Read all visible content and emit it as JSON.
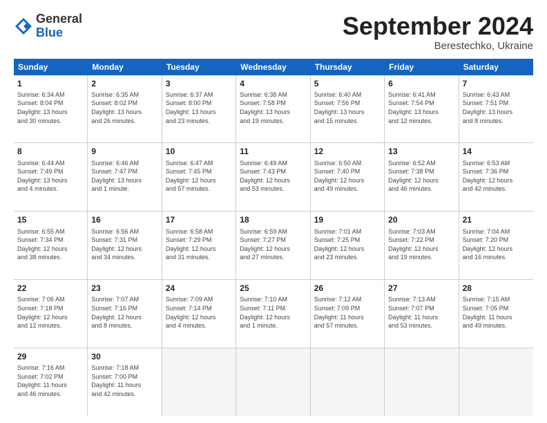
{
  "header": {
    "logo_general": "General",
    "logo_blue": "Blue",
    "month_title": "September 2024",
    "subtitle": "Berestechko, Ukraine"
  },
  "weekdays": [
    "Sunday",
    "Monday",
    "Tuesday",
    "Wednesday",
    "Thursday",
    "Friday",
    "Saturday"
  ],
  "rows": [
    [
      {
        "day": "1",
        "info": "Sunrise: 6:34 AM\nSunset: 8:04 PM\nDaylight: 13 hours\nand 30 minutes."
      },
      {
        "day": "2",
        "info": "Sunrise: 6:35 AM\nSunset: 8:02 PM\nDaylight: 13 hours\nand 26 minutes."
      },
      {
        "day": "3",
        "info": "Sunrise: 6:37 AM\nSunset: 8:00 PM\nDaylight: 13 hours\nand 23 minutes."
      },
      {
        "day": "4",
        "info": "Sunrise: 6:38 AM\nSunset: 7:58 PM\nDaylight: 13 hours\nand 19 minutes."
      },
      {
        "day": "5",
        "info": "Sunrise: 6:40 AM\nSunset: 7:56 PM\nDaylight: 13 hours\nand 15 minutes."
      },
      {
        "day": "6",
        "info": "Sunrise: 6:41 AM\nSunset: 7:54 PM\nDaylight: 13 hours\nand 12 minutes."
      },
      {
        "day": "7",
        "info": "Sunrise: 6:43 AM\nSunset: 7:51 PM\nDaylight: 13 hours\nand 8 minutes."
      }
    ],
    [
      {
        "day": "8",
        "info": "Sunrise: 6:44 AM\nSunset: 7:49 PM\nDaylight: 13 hours\nand 4 minutes."
      },
      {
        "day": "9",
        "info": "Sunrise: 6:46 AM\nSunset: 7:47 PM\nDaylight: 13 hours\nand 1 minute."
      },
      {
        "day": "10",
        "info": "Sunrise: 6:47 AM\nSunset: 7:45 PM\nDaylight: 12 hours\nand 57 minutes."
      },
      {
        "day": "11",
        "info": "Sunrise: 6:49 AM\nSunset: 7:43 PM\nDaylight: 12 hours\nand 53 minutes."
      },
      {
        "day": "12",
        "info": "Sunrise: 6:50 AM\nSunset: 7:40 PM\nDaylight: 12 hours\nand 49 minutes."
      },
      {
        "day": "13",
        "info": "Sunrise: 6:52 AM\nSunset: 7:38 PM\nDaylight: 12 hours\nand 46 minutes."
      },
      {
        "day": "14",
        "info": "Sunrise: 6:53 AM\nSunset: 7:36 PM\nDaylight: 12 hours\nand 42 minutes."
      }
    ],
    [
      {
        "day": "15",
        "info": "Sunrise: 6:55 AM\nSunset: 7:34 PM\nDaylight: 12 hours\nand 38 minutes."
      },
      {
        "day": "16",
        "info": "Sunrise: 6:56 AM\nSunset: 7:31 PM\nDaylight: 12 hours\nand 34 minutes."
      },
      {
        "day": "17",
        "info": "Sunrise: 6:58 AM\nSunset: 7:29 PM\nDaylight: 12 hours\nand 31 minutes."
      },
      {
        "day": "18",
        "info": "Sunrise: 6:59 AM\nSunset: 7:27 PM\nDaylight: 12 hours\nand 27 minutes."
      },
      {
        "day": "19",
        "info": "Sunrise: 7:01 AM\nSunset: 7:25 PM\nDaylight: 12 hours\nand 23 minutes."
      },
      {
        "day": "20",
        "info": "Sunrise: 7:03 AM\nSunset: 7:22 PM\nDaylight: 12 hours\nand 19 minutes."
      },
      {
        "day": "21",
        "info": "Sunrise: 7:04 AM\nSunset: 7:20 PM\nDaylight: 12 hours\nand 16 minutes."
      }
    ],
    [
      {
        "day": "22",
        "info": "Sunrise: 7:06 AM\nSunset: 7:18 PM\nDaylight: 12 hours\nand 12 minutes."
      },
      {
        "day": "23",
        "info": "Sunrise: 7:07 AM\nSunset: 7:16 PM\nDaylight: 12 hours\nand 8 minutes."
      },
      {
        "day": "24",
        "info": "Sunrise: 7:09 AM\nSunset: 7:14 PM\nDaylight: 12 hours\nand 4 minutes."
      },
      {
        "day": "25",
        "info": "Sunrise: 7:10 AM\nSunset: 7:11 PM\nDaylight: 12 hours\nand 1 minute."
      },
      {
        "day": "26",
        "info": "Sunrise: 7:12 AM\nSunset: 7:09 PM\nDaylight: 11 hours\nand 57 minutes."
      },
      {
        "day": "27",
        "info": "Sunrise: 7:13 AM\nSunset: 7:07 PM\nDaylight: 11 hours\nand 53 minutes."
      },
      {
        "day": "28",
        "info": "Sunrise: 7:15 AM\nSunset: 7:05 PM\nDaylight: 11 hours\nand 49 minutes."
      }
    ],
    [
      {
        "day": "29",
        "info": "Sunrise: 7:16 AM\nSunset: 7:02 PM\nDaylight: 11 hours\nand 46 minutes."
      },
      {
        "day": "30",
        "info": "Sunrise: 7:18 AM\nSunset: 7:00 PM\nDaylight: 11 hours\nand 42 minutes."
      },
      {
        "day": "",
        "info": ""
      },
      {
        "day": "",
        "info": ""
      },
      {
        "day": "",
        "info": ""
      },
      {
        "day": "",
        "info": ""
      },
      {
        "day": "",
        "info": ""
      }
    ]
  ]
}
